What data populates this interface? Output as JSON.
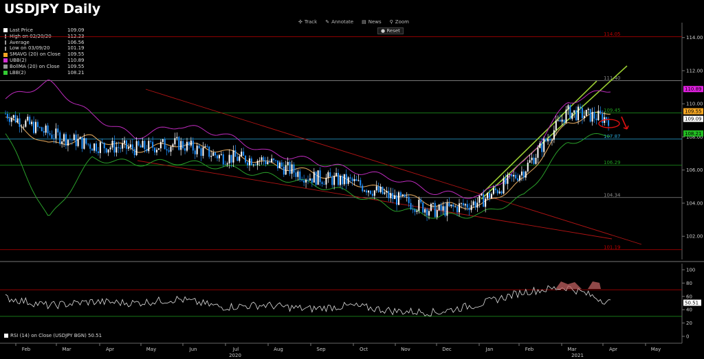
{
  "title": "USDJPY Daily",
  "toolbar": {
    "track": "Track",
    "annotate": "Annotate",
    "news": "News",
    "zoom": "Zoom",
    "reset": "Reset"
  },
  "legend": [
    {
      "name": "Last Price",
      "value": "109.09",
      "color": "#ffffff"
    },
    {
      "name": "High on 02/20/20",
      "value": "112.23",
      "color": ""
    },
    {
      "name": "Average",
      "value": "106.56",
      "color": ""
    },
    {
      "name": "Low on 03/09/20",
      "value": "101.19",
      "color": ""
    },
    {
      "name": "SMAVG (20)  on Close",
      "value": "109.55",
      "color": "#f5a623"
    },
    {
      "name": "UBB(2)",
      "value": "110.89",
      "color": "#d42fd4"
    },
    {
      "name": "BollMA (20)  on Close",
      "value": "109.55",
      "color": "#999999"
    },
    {
      "name": "LBB(2)",
      "value": "108.21",
      "color": "#33cc33"
    }
  ],
  "rsi_legend": "RSI (14)  on Close (USDJPY BGN) 50.51",
  "x_months": [
    "Feb",
    "Mar",
    "Apr",
    "May",
    "Jun",
    "Jul",
    "Aug",
    "Sep",
    "Oct",
    "Nov",
    "Dec",
    "Jan",
    "Feb",
    "Mar",
    "Apr",
    "May"
  ],
  "x_years": [
    "2020",
    "2021"
  ],
  "price_axis": {
    "ticks": [
      "114.00",
      "112.00",
      "110.00",
      "108.00",
      "106.00",
      "104.00",
      "102.00"
    ],
    "min": 100.6,
    "max": 114.9
  },
  "price_tags": [
    {
      "label": "110.89",
      "color": "#e020e0"
    },
    {
      "label": "109.55",
      "color": "#f5a623"
    },
    {
      "label": "109.09",
      "color": "#ffffff"
    },
    {
      "label": "108.21",
      "color": "#22bb22"
    }
  ],
  "levels": [
    {
      "label": "114.05",
      "value": 114.05,
      "color": "#c00000"
    },
    {
      "label": "111.40",
      "value": 111.4,
      "color": "#8a8a8a"
    },
    {
      "label": "109.45",
      "value": 109.45,
      "color": "#1f9e1f"
    },
    {
      "label": "107.87",
      "value": 107.87,
      "color": "#2aa4d4"
    },
    {
      "label": "106.29",
      "value": 106.29,
      "color": "#1f9e1f"
    },
    {
      "label": "104.34",
      "value": 104.34,
      "color": "#8a8a8a"
    },
    {
      "label": "101.19",
      "value": 101.19,
      "color": "#c00000"
    }
  ],
  "rsi_axis": {
    "ticks": [
      "100",
      "80",
      "60",
      "40",
      "20",
      "0"
    ],
    "value_tag": "50.51",
    "overbought": 70,
    "oversold": 30
  },
  "chart_data": {
    "type": "line",
    "title": "USDJPY Daily",
    "x": [
      "2020-02",
      "2020-03",
      "2020-04",
      "2020-05",
      "2020-06",
      "2020-07",
      "2020-08",
      "2020-09",
      "2020-10",
      "2020-11",
      "2020-12",
      "2021-01",
      "2021-02",
      "2021-03",
      "2021-04"
    ],
    "series": [
      {
        "name": "Last Price",
        "values": [
          109.4,
          108.2,
          107.5,
          107.3,
          107.6,
          106.8,
          106.6,
          105.6,
          105.3,
          104.3,
          103.5,
          104.1,
          106.0,
          109.5,
          109.09
        ]
      },
      {
        "name": "SMAVG (20)  on Close",
        "values": [
          109.2,
          107.5,
          108.0,
          107.2,
          107.6,
          107.2,
          106.4,
          105.9,
          105.3,
          104.6,
          103.9,
          103.8,
          105.4,
          108.9,
          109.55
        ]
      },
      {
        "name": "UBB(2)",
        "values": [
          110.3,
          111.3,
          109.3,
          108.0,
          108.7,
          108.2,
          107.1,
          106.6,
          106.0,
          105.5,
          104.6,
          104.4,
          106.4,
          110.1,
          110.89
        ]
      },
      {
        "name": "LBB(2)",
        "values": [
          108.2,
          103.0,
          106.7,
          106.4,
          106.5,
          106.2,
          105.7,
          105.2,
          104.6,
          103.7,
          103.2,
          103.3,
          104.4,
          107.7,
          108.21
        ]
      }
    ],
    "rsi": {
      "name": "RSI (14)  on Close (USDJPY BGN)",
      "last": 50.51,
      "values": [
        58,
        46,
        52,
        50,
        56,
        44,
        47,
        41,
        46,
        38,
        36,
        49,
        67,
        74,
        50.51
      ]
    },
    "ylim": [
      100.6,
      114.9
    ],
    "grid": false,
    "legend_position": "top-left"
  }
}
